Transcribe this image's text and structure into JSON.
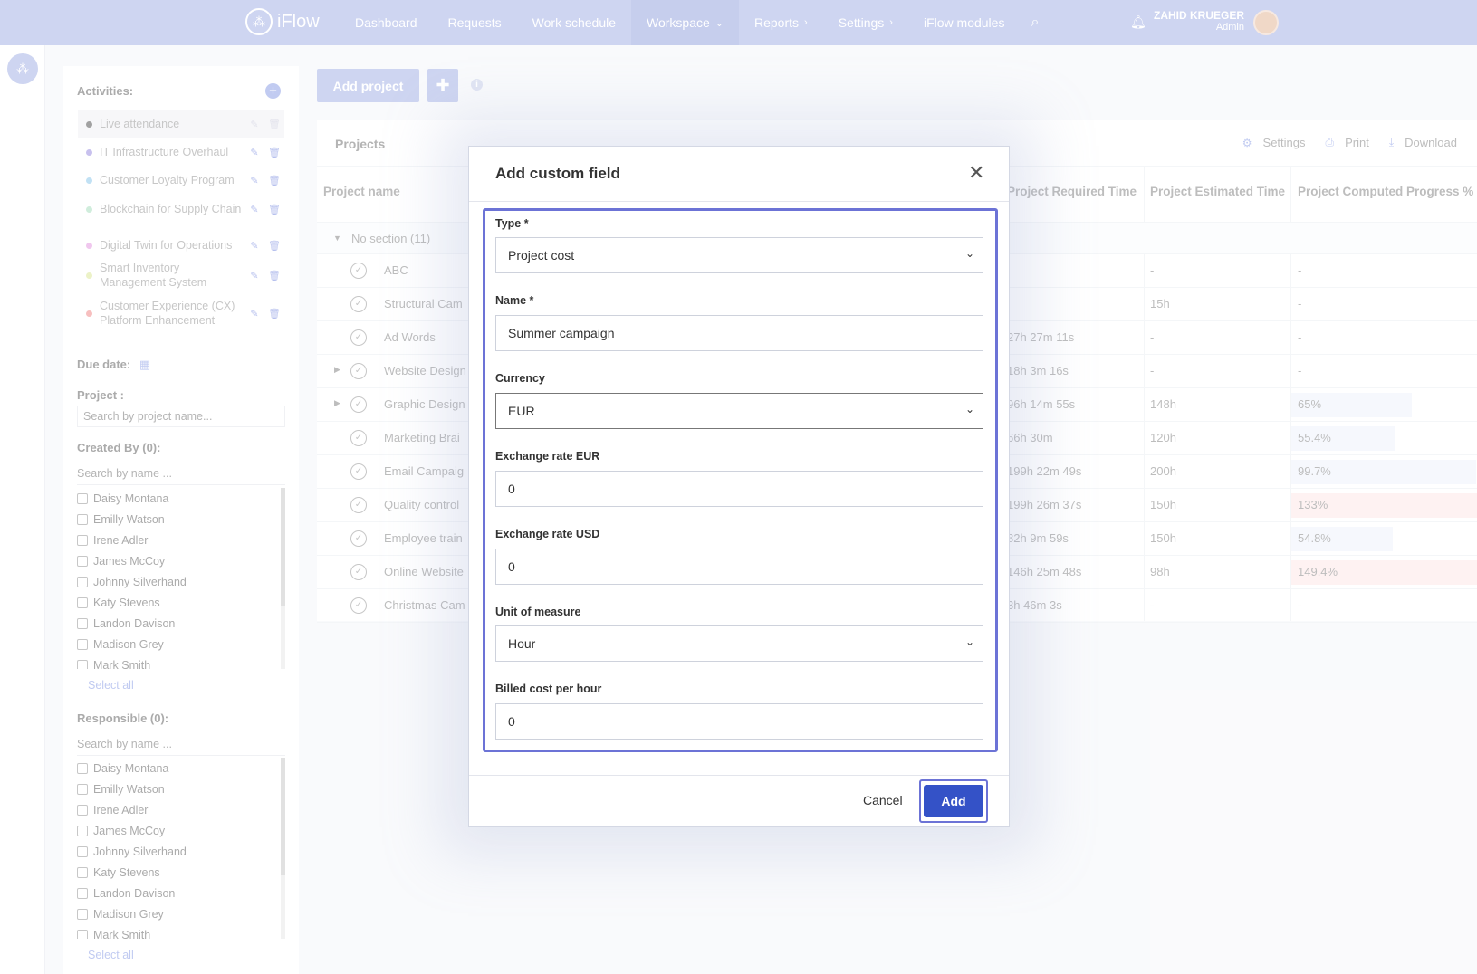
{
  "app": {
    "logo_text": "iFlow"
  },
  "nav": {
    "items": [
      {
        "label": "Dashboard",
        "chevron": ""
      },
      {
        "label": "Requests",
        "chevron": ""
      },
      {
        "label": "Work schedule",
        "chevron": ""
      },
      {
        "label": "Workspace",
        "chevron": "⌄"
      },
      {
        "label": "Reports",
        "chevron": "›"
      },
      {
        "label": "Settings",
        "chevron": "›"
      },
      {
        "label": "iFlow modules",
        "chevron": ""
      }
    ]
  },
  "user": {
    "name": "ZAHID KRUEGER",
    "role": "Admin"
  },
  "sidebar": {
    "activities_heading": "Activities:",
    "activities": [
      {
        "label": "Live attendance",
        "color": "#555555"
      },
      {
        "label": "IT Infrastructure Overhaul",
        "color": "#9b8fe0"
      },
      {
        "label": "Customer Loyalty Program",
        "color": "#8fc8ec"
      },
      {
        "label": "Blockchain for Supply Chain",
        "color": "#a9dfc0"
      },
      {
        "label": "Digital Twin for Operations",
        "color": "#e39ae0"
      },
      {
        "label": "Smart Inventory Management System",
        "color": "#dce89a"
      },
      {
        "label": "Customer Experience (CX) Platform Enhancement",
        "color": "#f08a8a"
      }
    ],
    "due_date_label": "Due date:",
    "project_label": "Project :",
    "project_placeholder": "Search by project name...",
    "created_by_label": "Created By (0):",
    "created_by_search": "Search by name ...",
    "responsible_label": "Responsible (0):",
    "responsible_search": "Search by name ...",
    "people": [
      "Daisy Montana",
      "Emilly Watson",
      "Irene Adler",
      "James McCoy",
      "Johnny Silverhand",
      "Katy Stevens",
      "Landon Davison",
      "Madison Grey",
      "Mark Smith"
    ],
    "select_all": "Select all"
  },
  "toolbar": {
    "add_project": "Add project"
  },
  "projects": {
    "title": "Projects",
    "tools": {
      "settings": "Settings",
      "print": "Print",
      "download": "Download"
    },
    "columns": {
      "name": "Project name",
      "required": "Project Required Time",
      "estimated": "Project Estimated Time",
      "progress": "Project Computed Progress %"
    },
    "section": "No section (11)",
    "rows": [
      {
        "name": "ABC",
        "required": "",
        "estimated": "-",
        "progress": "-",
        "expand": false
      },
      {
        "name": "Structural Cam",
        "required": "",
        "estimated": "15h",
        "progress": "-",
        "expand": false
      },
      {
        "name": "Ad Words",
        "required": "27h 27m 11s",
        "estimated": "-",
        "progress": "-",
        "expand": false
      },
      {
        "name": "Website Design",
        "required": "18h 3m 16s",
        "estimated": "-",
        "progress": "-",
        "expand": true
      },
      {
        "name": "Graphic Design",
        "required": "96h 14m 55s",
        "estimated": "148h",
        "progress": "65%",
        "expand": true,
        "bar": 0.65
      },
      {
        "name": "Marketing Brai",
        "required": "66h 30m",
        "estimated": "120h",
        "progress": "55.4%",
        "expand": false,
        "bar": 0.554
      },
      {
        "name": "Email Campaig",
        "required": "199h 22m 49s",
        "estimated": "200h",
        "progress": "99.7%",
        "expand": false,
        "bar": 0.997
      },
      {
        "name": "Quality control",
        "required": "199h 26m 37s",
        "estimated": "150h",
        "progress": "133%",
        "expand": false,
        "bar": 1.0,
        "over": true
      },
      {
        "name": "Employee train",
        "required": "82h 9m 59s",
        "estimated": "150h",
        "progress": "54.8%",
        "expand": false,
        "bar": 0.548
      },
      {
        "name": "Online Website",
        "required": "146h 25m 48s",
        "estimated": "98h",
        "progress": "149.4%",
        "expand": false,
        "bar": 1.0,
        "over": true
      },
      {
        "name": "Christmas Cam",
        "required": "3h 46m 3s",
        "estimated": "-",
        "progress": "-",
        "expand": false
      }
    ]
  },
  "modal": {
    "title": "Add custom field",
    "type_label": "Type *",
    "type_value": "Project cost",
    "name_label": "Name *",
    "name_value": "Summer campaign",
    "currency_label": "Currency",
    "currency_value": "EUR",
    "rate_eur_label": "Exchange rate EUR",
    "rate_eur_value": "0",
    "rate_usd_label": "Exchange rate USD",
    "rate_usd_value": "0",
    "unit_label": "Unit of measure",
    "unit_value": "Hour",
    "billed_label": "Billed cost per hour",
    "billed_value": "0",
    "cancel": "Cancel",
    "add": "Add"
  }
}
